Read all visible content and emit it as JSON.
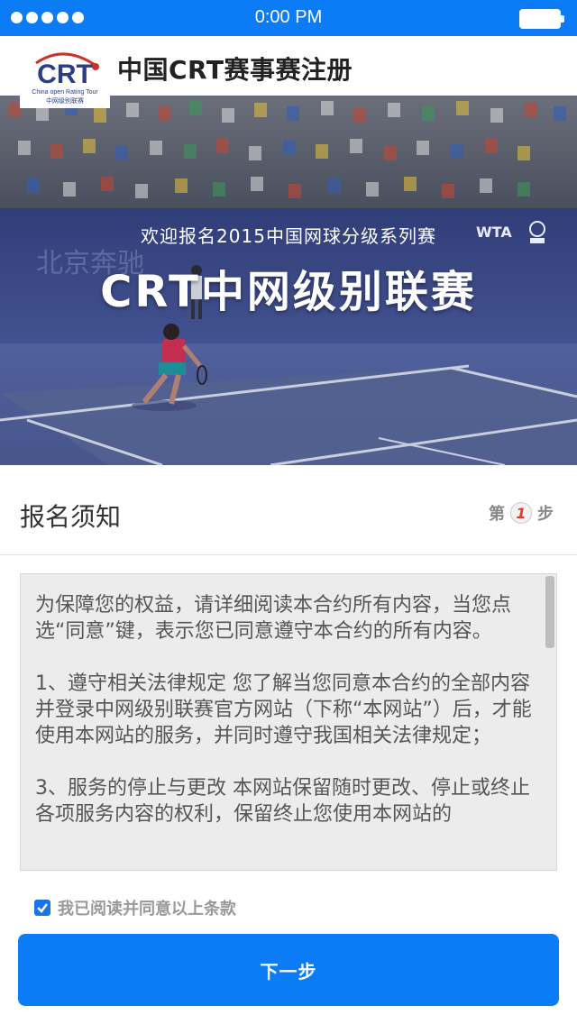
{
  "status_bar": {
    "time": "0:00 PM",
    "signal_icon": "signal-dots-icon",
    "battery_icon": "battery-icon"
  },
  "header": {
    "logo": {
      "text": "CRT",
      "subtitle": "China open Rating Tour",
      "caption": "中网级别联赛"
    },
    "title": "中国CRT赛事赛注册"
  },
  "banner": {
    "subtitle": "欢迎报名2015中国网球分级系列赛",
    "title": "CRT中网级别联赛",
    "wta": "WTA",
    "atp_icon": "atp-500-icon"
  },
  "section": {
    "title": "报名须知",
    "step_prefix": "第",
    "step_number": "1",
    "step_suffix": "步"
  },
  "agreement": {
    "paragraphs": [
      "为保障您的权益，请详细阅读本合约所有内容，当您点选“同意”键，表示您已同意遵守本合约的所有内容。",
      " 1、遵守相关法律规定 您了解当您同意本合约的全部内容并登录中网级别联赛官方网站（下称“本网站”）后，才能使用本网站的服务，并同时遵守我国相关法律规定；",
      "3、服务的停止与更改 本网站保留随时更改、停止或终止各项服务内容的权利，保留终止您使用本网站的"
    ]
  },
  "consent": {
    "label": "我已阅读并同意以上条款",
    "checked": true
  },
  "next_button": {
    "label": "下一步"
  },
  "colors": {
    "primary": "#0b7cf5",
    "court": "#3e4f8f",
    "step_number": "#e23b2e"
  }
}
